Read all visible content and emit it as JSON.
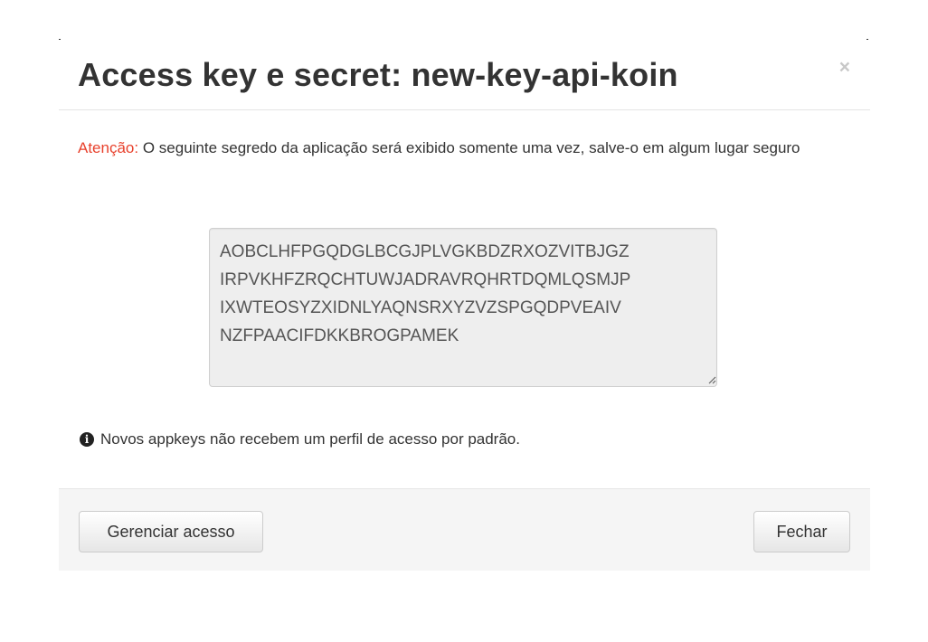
{
  "modal": {
    "title": "Access key e secret: new-key-api-koin",
    "close_glyph": "×"
  },
  "body": {
    "warning_label": "Atenção:",
    "warning_text": " O seguinte segredo da aplicação será exibido somente uma vez, salve-o em algum lugar seguro",
    "secret": "AOBCLHFPGQDGLBCGJPLVGKBDZRXOZVITBJGZ\nIRPVKHFZRQCHTUWJADRAVRQHRTDQMLQSMJP\nIXWTEOSYZXIDNLYAQNSRXYZVZSPGQDPVEAIV\nNZFPAACIFDKKBROGPAMEK",
    "info_icon": "info-circle-icon",
    "info_text": "Novos appkeys não recebem um perfil de acesso por padrão."
  },
  "footer": {
    "manage_label": "Gerenciar acesso",
    "close_label": "Fechar"
  },
  "colors": {
    "warning": "#e8412c",
    "text": "#333333",
    "secret_bg": "#eeeeee",
    "footer_bg": "#f5f5f5"
  }
}
